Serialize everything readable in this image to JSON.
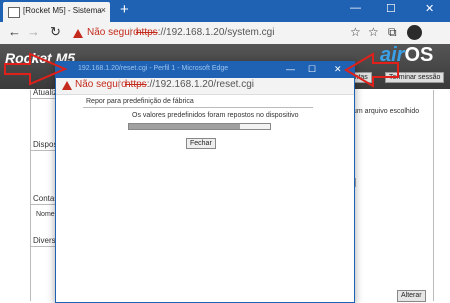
{
  "browser": {
    "tab_title": "[Rocket M5] - Sistema",
    "tab_close": "×",
    "new_tab": "+",
    "window_controls": [
      "—",
      "☐",
      "✕"
    ],
    "nav": {
      "back": "←",
      "forward": "→",
      "reload": "↻"
    },
    "address": {
      "security_label": "Não seguro",
      "separator": "|",
      "scheme": "https",
      "url_rest": "://192.168.1.20/system.cgi"
    },
    "toolbar_icons": [
      "☆",
      "☆",
      "⧉"
    ]
  },
  "page": {
    "logo": "Rocket M5",
    "airos_air": "air",
    "airos_os": "OS",
    "header_buttons": [
      "...mentas",
      "Terminar sessão"
    ],
    "sections": [
      {
        "label": "Atualiz..."
      },
      {
        "label": "Disposit..."
      },
      {
        "label": "Contas d..."
      },
      {
        "label": "Diversos"
      }
    ],
    "field_labels": [
      "Nome de"
    ],
    "upgrade_text": "um arquivo escolhido",
    "alterar_label": "Alterar"
  },
  "popup": {
    "title_text": "192.168.1.20/reset.cgi - Perfil 1 - Microsoft Edge",
    "window_controls": [
      "—",
      "☐",
      "✕"
    ],
    "address": {
      "security_label": "Não seguro",
      "separator": "|",
      "scheme": "https",
      "url_rest": "://192.168.1.20/reset.cgi"
    },
    "heading": "Repor para predefinição de fábrica",
    "message": "Os valores predefinidos foram repostos no dispositivo",
    "progress_fraction": 0.79,
    "close_button": "Fechar"
  },
  "colors": {
    "brand_blue": "#1f62b4",
    "warning_red": "#c42b1c",
    "arrow_red": "#e0201a"
  }
}
